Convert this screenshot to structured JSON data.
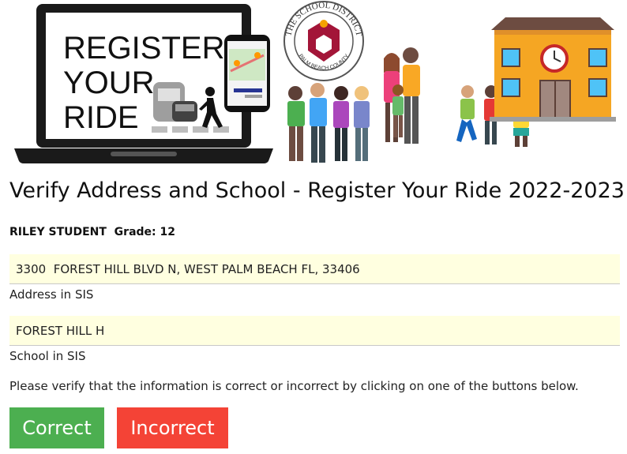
{
  "banner": {
    "laptop_text": [
      "REGISTER",
      "YOUR",
      "RIDE"
    ],
    "seal_top_text": "THE SCHOOL DISTRICT",
    "seal_bottom_text": "PALM BEACH COUNTY"
  },
  "page": {
    "title": "Verify Address and School - Register Your Ride 2022-2023"
  },
  "student": {
    "label": "RILEY STUDENT  Grade: 12"
  },
  "address": {
    "value": "3300  FOREST HILL BLVD N, WEST PALM BEACH FL, 33406",
    "caption": "Address in SIS"
  },
  "school": {
    "value": "FOREST HILL H",
    "caption": "School in SIS"
  },
  "instructions": "Please verify that the information is correct or incorrect by clicking on one of the buttons below.",
  "buttons": {
    "correct": "Correct",
    "incorrect": "Incorrect"
  },
  "colors": {
    "correct": "#4caf50",
    "incorrect": "#f44336",
    "field_bg": "#ffffe0"
  }
}
